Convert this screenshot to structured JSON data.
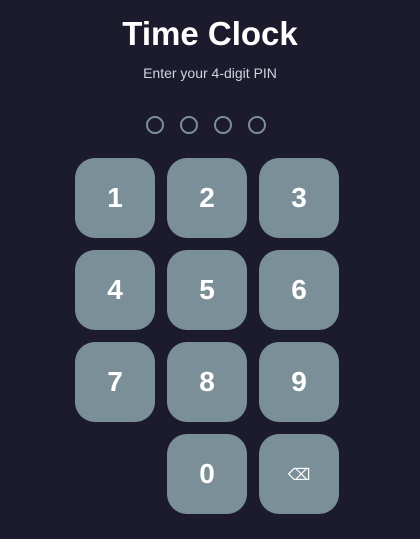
{
  "header": {
    "title": "Time Clock",
    "subtitle": "Enter your 4-digit PIN"
  },
  "pin": {
    "length": 4,
    "entered": 0
  },
  "keypad": {
    "keys": [
      "1",
      "2",
      "3",
      "4",
      "5",
      "6",
      "7",
      "8",
      "9",
      "0"
    ],
    "backspace_icon": "⌫"
  },
  "colors": {
    "background": "#1b1b2d",
    "key": "#7b8f99",
    "dot_border": "#7b8f99",
    "text": "#ffffff"
  }
}
